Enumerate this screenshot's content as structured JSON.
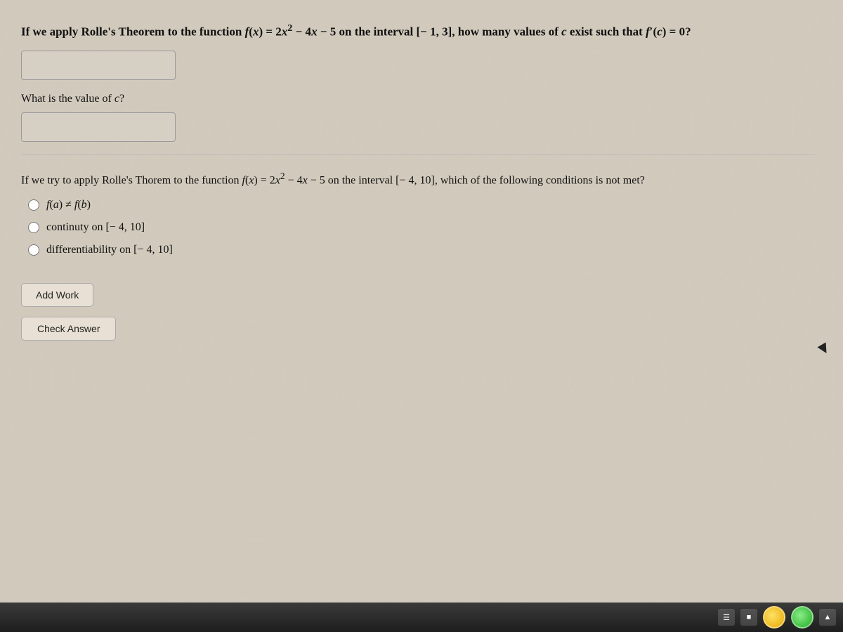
{
  "page": {
    "background_color": "#c8bfb0"
  },
  "question1": {
    "text": "If we apply Rolle's Theorem to the function f(x) = 2x² − 4x − 5 on the interval [− 1, 3], how many values of c exist such that f′(c) = 0?",
    "answer_placeholder": ""
  },
  "sub_question1": {
    "label": "What is the value of c?",
    "answer_placeholder": ""
  },
  "question2": {
    "text": "If we try to apply Rolle's Thorem to the function f(x) = 2x² − 4x − 5 on the interval [− 4, 10], which of the following conditions is not met?",
    "options": [
      {
        "id": "opt1",
        "label": "f(a) ≠ f(b)",
        "checked": false
      },
      {
        "id": "opt2",
        "label": "continuty on [− 4, 10]",
        "checked": false
      },
      {
        "id": "opt3",
        "label": "differentiability on [− 4, 10]",
        "checked": false
      }
    ]
  },
  "buttons": {
    "add_work": "Add Work",
    "check_answer": "Check Answer"
  }
}
